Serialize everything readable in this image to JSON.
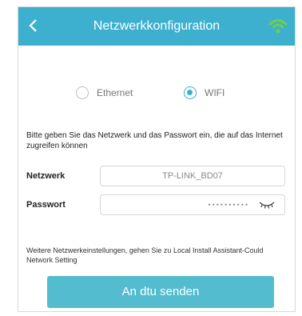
{
  "header": {
    "title": "Netzwerkkonfiguration",
    "back_icon": "chevron-left-icon",
    "right_icon": "wifi-signal-icon"
  },
  "connection": {
    "options": [
      {
        "label": "Ethernet",
        "selected": false
      },
      {
        "label": "WIFI",
        "selected": true
      }
    ]
  },
  "instructions": "Bitte geben Sie das Netzwerk und das Passwort ein, die auf das Internet zugreifen können",
  "form": {
    "network": {
      "label": "Netzwerk",
      "value": "TP-LINK_BD07"
    },
    "password": {
      "label": "Passwort",
      "value": "••••••••••",
      "toggle_icon": "eye-closed-icon"
    }
  },
  "more_info": "Weitere Netzwerkeinstellungen, gehen Sie zu Local Install Assistant-Could Network Setting",
  "send_button": {
    "label": "An dtu senden"
  },
  "colors": {
    "accent": "#3db0cf",
    "button": "#54bccf",
    "signal": "#6fcf4a"
  }
}
